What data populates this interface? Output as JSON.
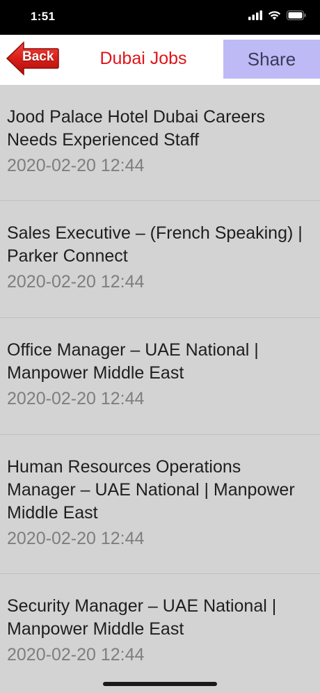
{
  "status_bar": {
    "time": "1:51"
  },
  "nav": {
    "back_label": "Back",
    "title": "Dubai Jobs",
    "share_label": "Share"
  },
  "jobs": [
    {
      "title": "Jood Palace Hotel Dubai Careers Needs Experienced Staff",
      "date": "2020-02-20 12:44"
    },
    {
      "title": "Sales Executive – (French Speaking) | Parker Connect",
      "date": "2020-02-20 12:44"
    },
    {
      "title": "Office Manager – UAE National | Manpower Middle East",
      "date": "2020-02-20 12:44"
    },
    {
      "title": "Human Resources Operations Manager – UAE National | Manpower Middle East",
      "date": "2020-02-20 12:44"
    },
    {
      "title": "Security Manager – UAE National | Manpower Middle East",
      "date": "2020-02-20 12:44"
    }
  ],
  "colors": {
    "title_red": "#e0141a",
    "share_bg": "#bebaf6",
    "list_bg": "#d3d3d3",
    "date_gray": "#7e7e7e"
  }
}
